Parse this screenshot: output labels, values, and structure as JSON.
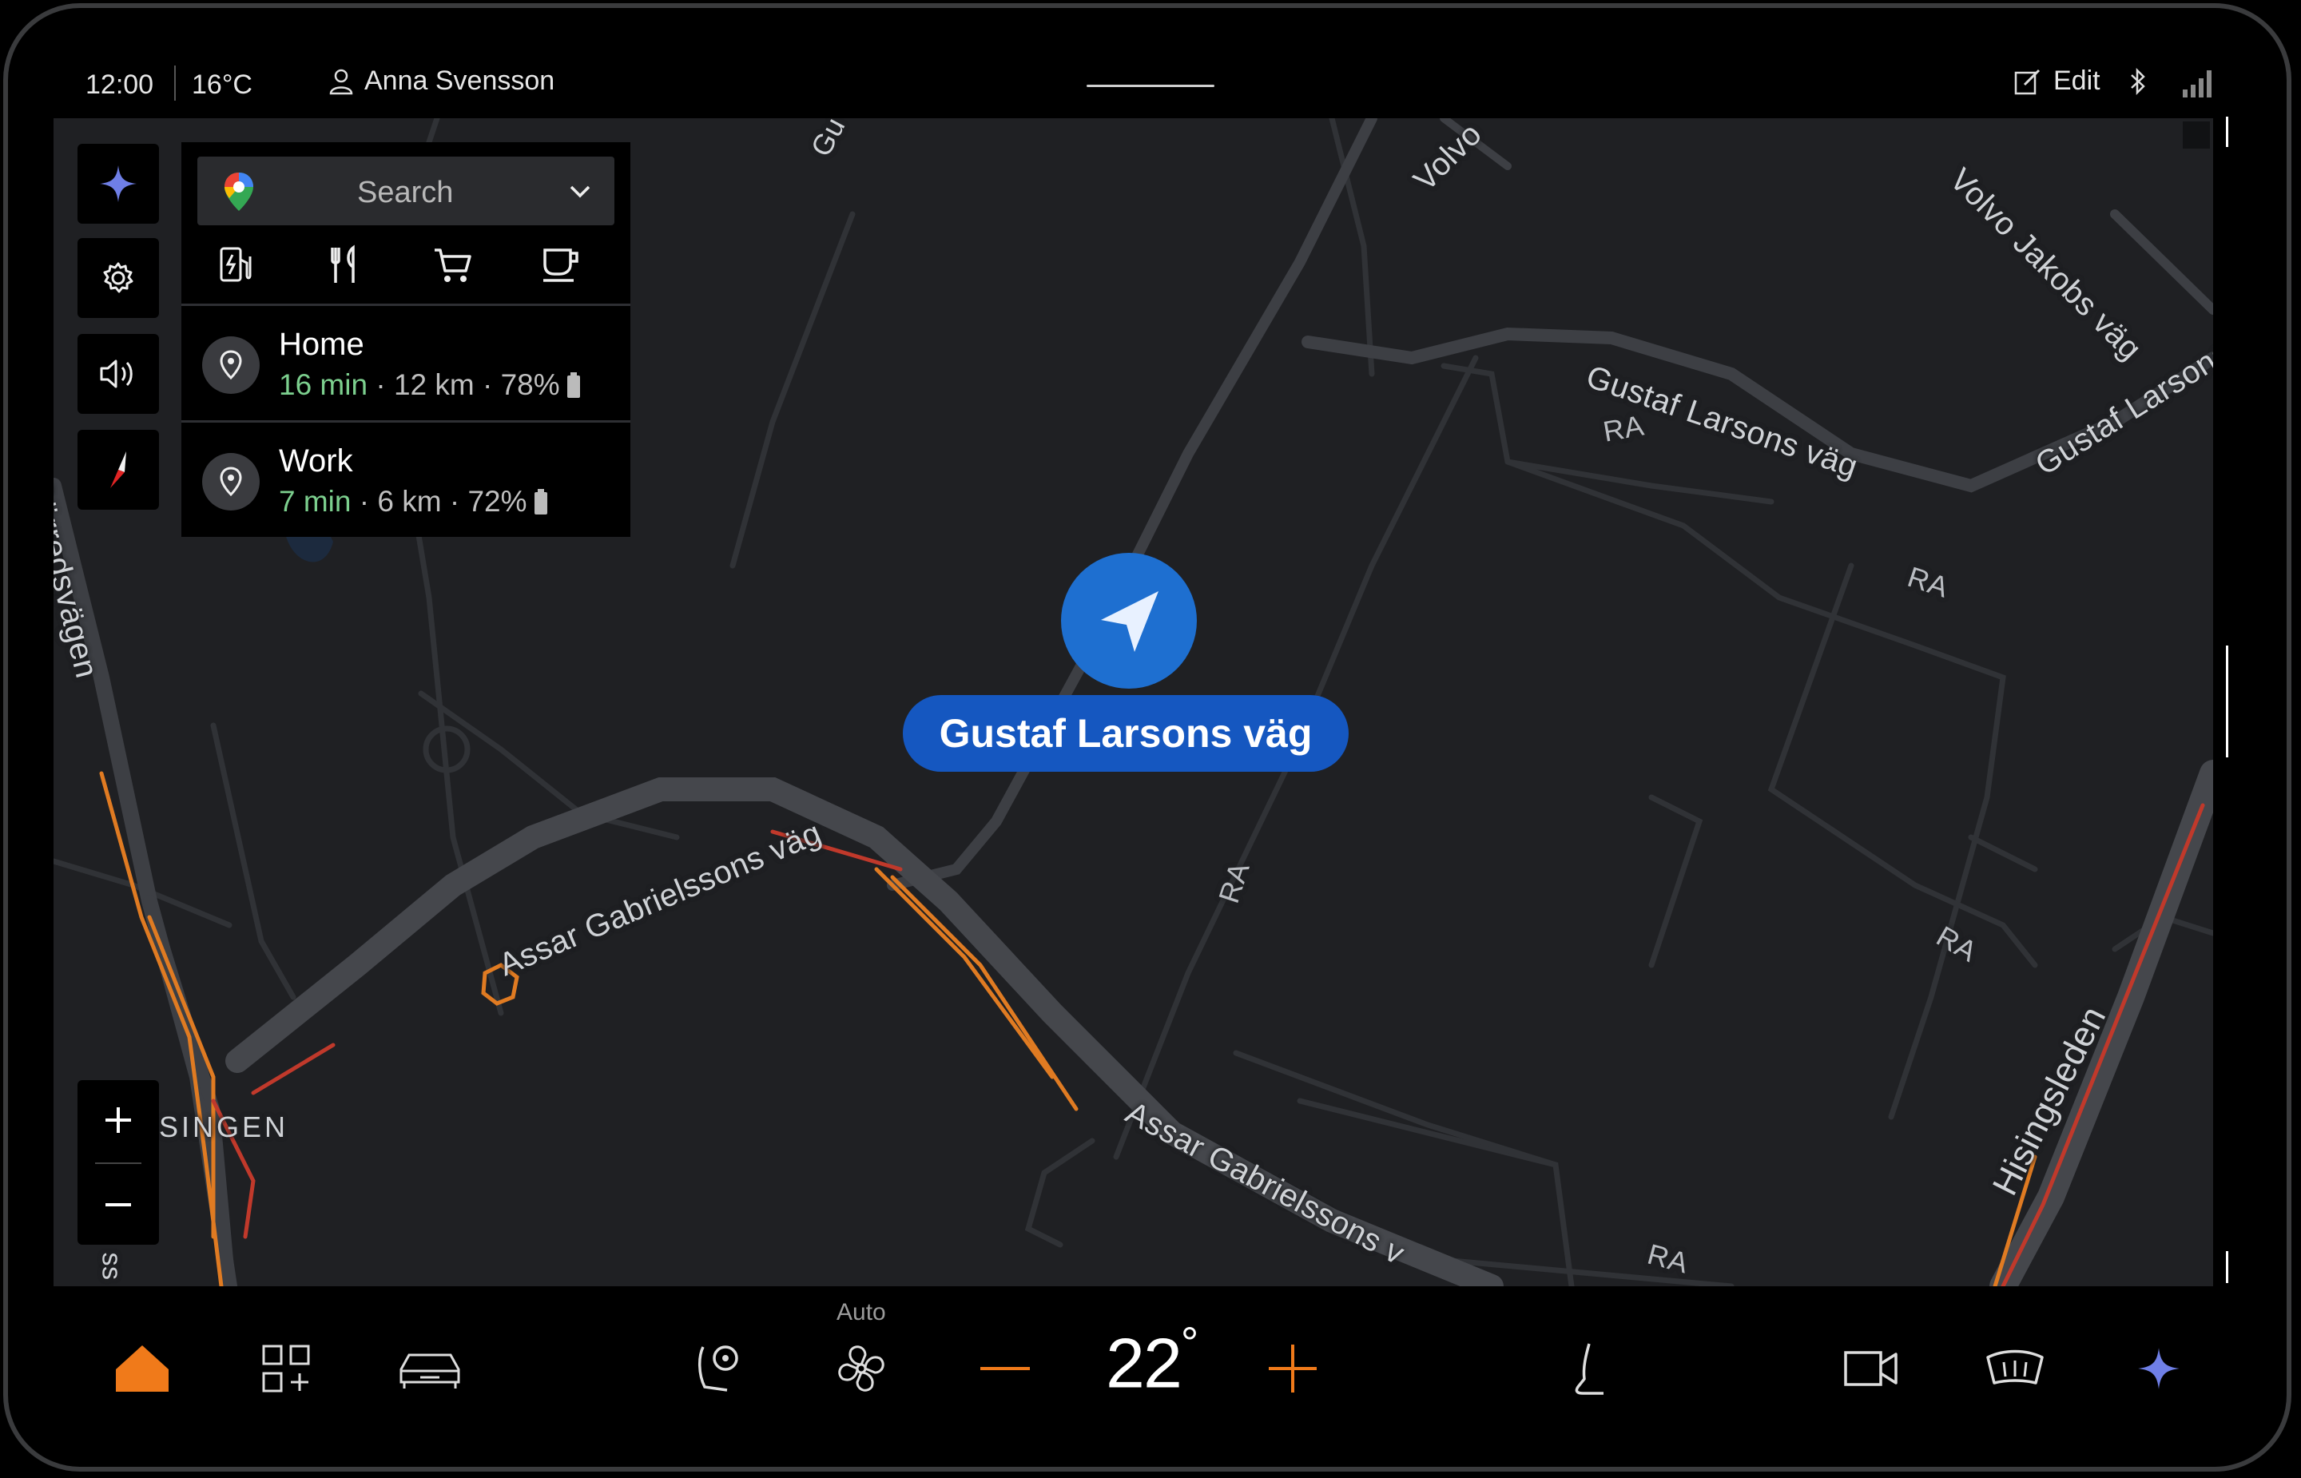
{
  "status_bar": {
    "time": "12:00",
    "temperature": "16°C",
    "user_name": "Anna Svensson",
    "edit_label": "Edit"
  },
  "search_panel": {
    "placeholder": "Search",
    "categories": [
      "ev-charging-icon",
      "restaurant-icon",
      "shopping-cart-icon",
      "coffee-icon"
    ],
    "destinations": [
      {
        "name": "Home",
        "eta": "16 min",
        "distance": "· 12 km ·",
        "battery": "78%"
      },
      {
        "name": "Work",
        "eta": "7 min",
        "distance": "· 6 km ·",
        "battery": "72%"
      }
    ]
  },
  "map": {
    "current_street": "Gustaf Larsons väg",
    "labels": {
      "gustaf_larsons_1": "Gustaf Larsons väg",
      "gustaf_larsons_2": "Gustaf Larsons",
      "volvo_jakobs": "Volvo Jakobs väg",
      "volvo_top": "Volvo",
      "assar_1": "Assar Gabrielssons väg",
      "assar_2": "Assar Gabrielssons v",
      "hisingsleden": "Hisingsleden",
      "sorredsvagen": "Sörredsvägen",
      "singen": "SINGEN",
      "ra": "RA",
      "gu": "Gu",
      "ss": "ss"
    },
    "colors": {
      "road": "#3d3f44",
      "road_edge": "#4a4c52",
      "traffic_orange": "#e07b22",
      "traffic_red": "#c0392b"
    }
  },
  "zoom": {
    "in_label": "+",
    "out_label": "−"
  },
  "climate": {
    "mode": "Auto",
    "temperature": "22",
    "unit": "°",
    "minus_label": "—",
    "plus_label": "+"
  },
  "accent_color": "#f07a1a"
}
